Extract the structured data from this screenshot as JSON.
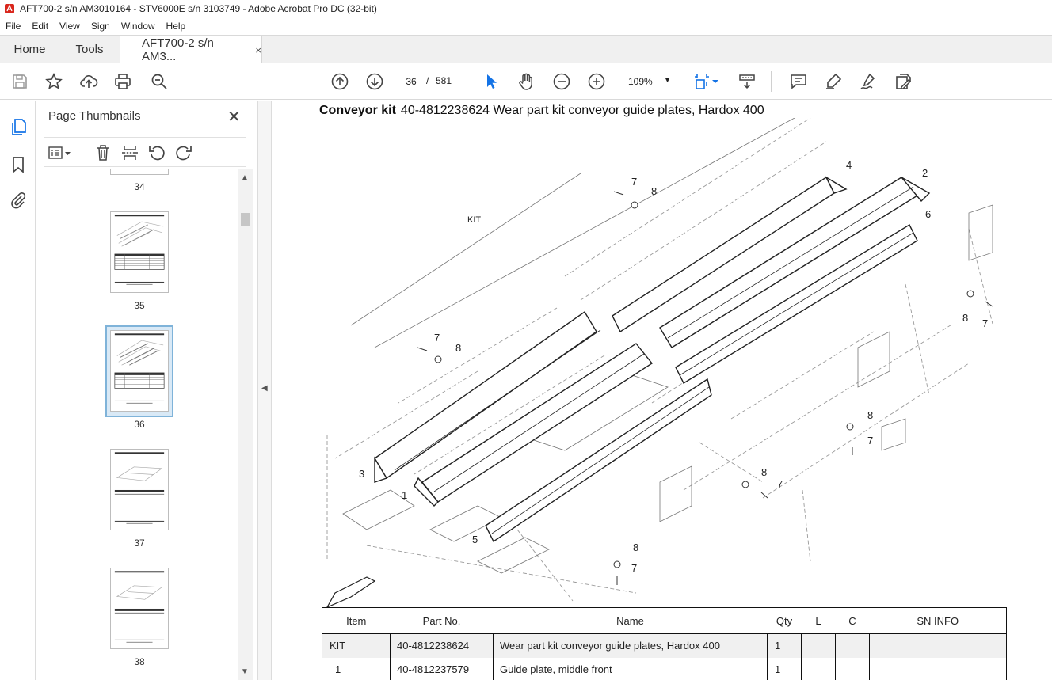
{
  "window": {
    "title": "AFT700-2 s/n AM3010164 - STV6000E s/n 3103749 - Adobe Acrobat Pro DC (32-bit)"
  },
  "menu": [
    "File",
    "Edit",
    "View",
    "Sign",
    "Window",
    "Help"
  ],
  "tabs": {
    "home": "Home",
    "tools": "Tools",
    "document": "AFT700-2 s/n AM3...",
    "close": "×"
  },
  "toolbar": {
    "current_page": "36",
    "page_separator": "/",
    "total_pages": "581",
    "zoom": "109%",
    "icons": [
      "save-icon",
      "star-icon",
      "upload-icon",
      "print-icon",
      "zoom-search-icon",
      "page-up-icon",
      "page-down-icon",
      "select-cursor-icon",
      "hand-icon",
      "zoom-out-icon",
      "zoom-in-icon",
      "fit-page-icon",
      "scroll-mode-icon",
      "comment-icon",
      "highlight-icon",
      "sign-icon",
      "tools-more-icon"
    ]
  },
  "rail": {
    "icons": [
      "page-thumbnails-icon",
      "bookmark-icon",
      "attachment-icon"
    ]
  },
  "thumbnails_panel": {
    "title": "Page Thumbnails",
    "close": "✕",
    "tools": [
      "options-menu-icon",
      "delete-icon",
      "extract-icon",
      "rotate-left-icon",
      "rotate-right-icon"
    ],
    "pages": [
      {
        "label": "34",
        "selected": false
      },
      {
        "label": "35",
        "selected": false
      },
      {
        "label": "36",
        "selected": true
      },
      {
        "label": "37",
        "selected": false
      },
      {
        "label": "38",
        "selected": false
      }
    ]
  },
  "document": {
    "heading_bold": "Conveyor kit",
    "heading_rest": "40-4812238624 Wear part kit conveyor guide plates, Hardox 400",
    "callouts": {
      "kit": "KIT",
      "c1": "1",
      "c2": "2",
      "c3": "3",
      "c4": "4",
      "c5": "5",
      "c6": "6",
      "c7": "7",
      "c8": "8"
    },
    "table": {
      "headers": [
        "Item",
        "Part No.",
        "Name",
        "Qty",
        "L",
        "C",
        "SN INFO"
      ],
      "rows": [
        [
          "KIT",
          "40-4812238624",
          "Wear part kit conveyor guide plates, Hardox 400",
          "1",
          "",
          "",
          ""
        ],
        [
          "1",
          "40-4812237579",
          "Guide plate, middle front",
          "1",
          "",
          "",
          ""
        ]
      ]
    }
  }
}
